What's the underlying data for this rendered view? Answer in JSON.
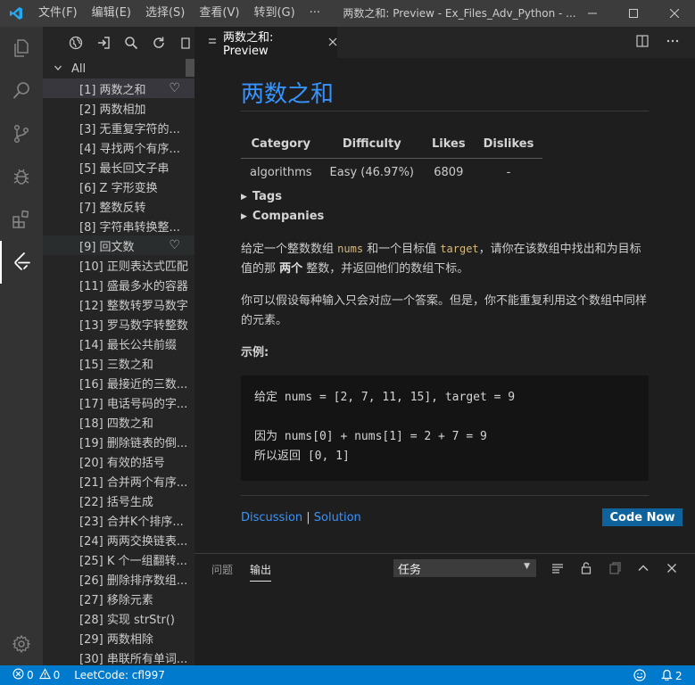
{
  "menu": {
    "items": [
      "文件(F)",
      "编辑(E)",
      "选择(S)",
      "查看(V)",
      "转到(G)",
      "···"
    ]
  },
  "window": {
    "title": "两数之和: Preview - Ex_Files_Adv_Python - ..."
  },
  "sidebar": {
    "group_label": "All",
    "items": [
      "[1] 两数之和",
      "[2] 两数相加",
      "[3] 无重复字符的...",
      "[4] 寻找两个有序...",
      "[5] 最长回文子串",
      "[6] Z 字形变换",
      "[7] 整数反转",
      "[8] 字符串转换整...",
      "[9] 回文数",
      "[10] 正则表达式匹配",
      "[11] 盛最多水的容器",
      "[12] 整数转罗马数字",
      "[13] 罗马数字转整数",
      "[14] 最长公共前缀",
      "[15] 三数之和",
      "[16] 最接近的三数...",
      "[17] 电话号码的字...",
      "[18] 四数之和",
      "[19] 删除链表的倒...",
      "[20] 有效的括号",
      "[21] 合并两个有序...",
      "[22] 括号生成",
      "[23] 合并K个排序...",
      "[24] 两两交换链表...",
      "[25] K 个一组翻转...",
      "[26] 删除排序数组...",
      "[27] 移除元素",
      "[28] 实现 strStr()",
      "[29] 两数相除",
      "[30] 串联所有单词..."
    ]
  },
  "tab": {
    "label": "两数之和: Preview"
  },
  "problem": {
    "title": "两数之和",
    "table_headers": [
      "Category",
      "Difficulty",
      "Likes",
      "Dislikes"
    ],
    "table_values": [
      "algorithms",
      "Easy (46.97%)",
      "6809",
      "-"
    ],
    "tags_label": "Tags",
    "companies_label": "Companies",
    "para1": {
      "t1": "给定一个整数数组 ",
      "c1": "nums",
      "t2": " 和一个目标值 ",
      "c2": "target",
      "t3": "，请你在该数组中找出和为目标值的那 ",
      "b1": "两个",
      "t4": " 整数，并返回他们的数组下标。"
    },
    "para2": "你可以假设每种输入只会对应一个答案。但是，你不能重复利用这个数组中同样的元素。",
    "example_label": "示例:",
    "code_lines": [
      "给定 nums = [2, 7, 11, 15], target = 9",
      "",
      "因为 nums[0] + nums[1] = 2 + 7 = 9",
      "所以返回 [0, 1]"
    ],
    "discussion_link": "Discussion",
    "separator": " | ",
    "solution_link": "Solution",
    "code_now_label": "Code Now"
  },
  "panel": {
    "tabs": [
      "问题",
      "输出"
    ],
    "select_value": "任务"
  },
  "status": {
    "errors": "0",
    "warnings": "0",
    "leetcode": "LeetCode: cfl997",
    "notifications": "2"
  },
  "colors": {
    "accent": "#007acc",
    "link": "#3794ff",
    "code_now": "#0e639c"
  }
}
